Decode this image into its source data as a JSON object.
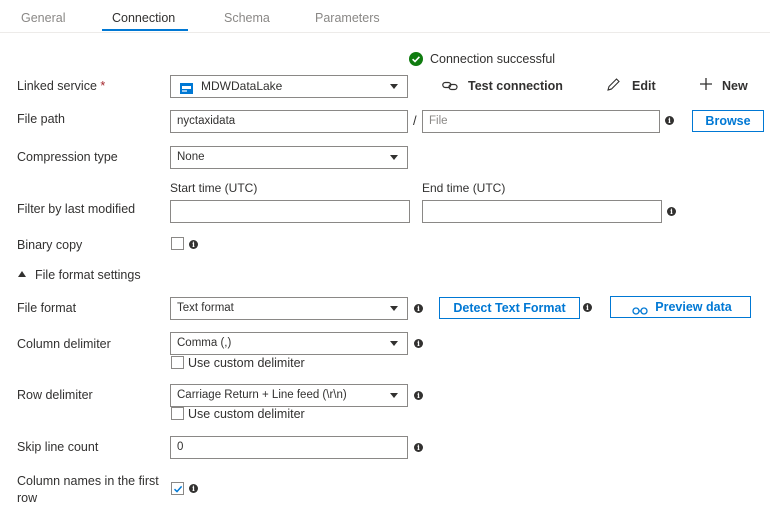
{
  "tabs": [
    {
      "label": "General"
    },
    {
      "label": "Connection"
    },
    {
      "label": "Schema"
    },
    {
      "label": "Parameters"
    }
  ],
  "status": {
    "text": "Connection successful",
    "color": "#107c10"
  },
  "linked_service": {
    "label": "Linked service",
    "required_mark": "*",
    "value": "MDWDataLake",
    "test_connection": "Test connection",
    "edit": "Edit",
    "new": "New"
  },
  "file_path": {
    "label": "File path",
    "folder_value": "nyctaxidata",
    "separator": "/",
    "file_placeholder": "File",
    "browse": "Browse"
  },
  "compression": {
    "label": "Compression type",
    "value": "None"
  },
  "filter": {
    "label": "Filter by last modified",
    "start_label": "Start time (UTC)",
    "end_label": "End time (UTC)",
    "start_value": "",
    "end_value": ""
  },
  "binary_copy": {
    "label": "Binary copy",
    "checked": false
  },
  "file_format_settings": {
    "label": "File format settings"
  },
  "file_format": {
    "label": "File format",
    "value": "Text format",
    "detect": "Detect Text Format",
    "preview": "Preview data"
  },
  "column_delimiter": {
    "label": "Column delimiter",
    "value": "Comma (,)",
    "custom_label": "Use custom delimiter",
    "custom_checked": false
  },
  "row_delimiter": {
    "label": "Row delimiter",
    "value": "Carriage Return + Line feed (\\r\\n)",
    "custom_label": "Use custom delimiter",
    "custom_checked": false
  },
  "skip_line_count": {
    "label": "Skip line count",
    "value": "0"
  },
  "column_names": {
    "label": "Column names in the first row",
    "checked": true
  },
  "accent_color": "#0078d4"
}
